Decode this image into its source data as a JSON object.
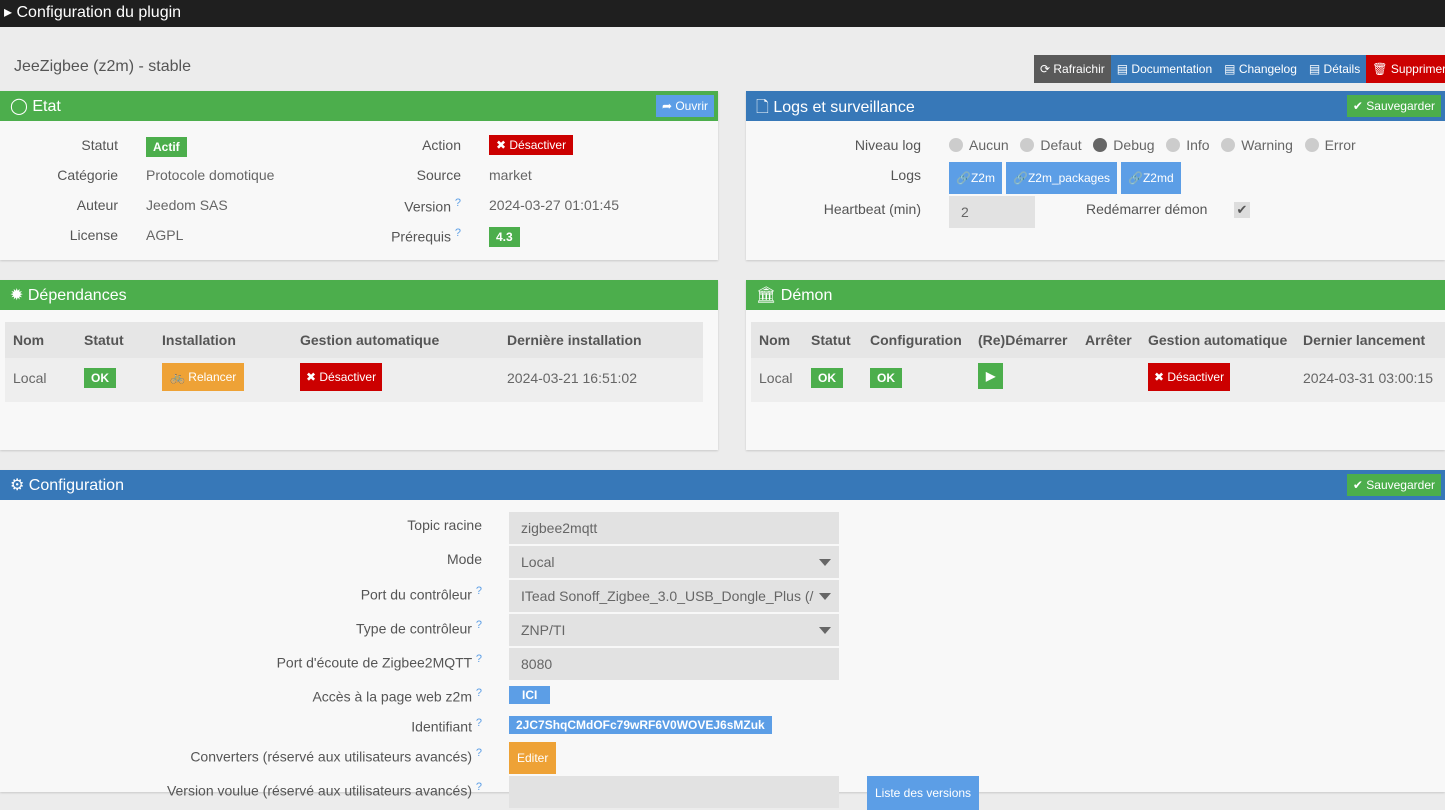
{
  "window_title": "Configuration du plugin",
  "plugin_title": "JeeZigbee (z2m) - stable",
  "toolbar": {
    "refresh": "Rafraichir",
    "documentation": "Documentation",
    "changelog": "Changelog",
    "details": "Détails",
    "delete": "Supprimer"
  },
  "etat": {
    "title": "Etat",
    "open": "Ouvrir",
    "statut_label": "Statut",
    "statut": "Actif",
    "categorie_label": "Catégorie",
    "categorie": "Protocole domotique",
    "auteur_label": "Auteur",
    "auteur": "Jeedom SAS",
    "license_label": "License",
    "license": "AGPL",
    "action_label": "Action",
    "action": "Désactiver",
    "source_label": "Source",
    "source": "market",
    "version_label": "Version",
    "version": "2024-03-27 01:01:45",
    "prerequis_label": "Prérequis",
    "prerequis": "4.3"
  },
  "logs": {
    "title": "Logs et surveillance",
    "save": "Sauvegarder",
    "niveau_label": "Niveau log",
    "levels": [
      "Aucun",
      "Defaut",
      "Debug",
      "Info",
      "Warning",
      "Error"
    ],
    "selected": "Debug",
    "logs_label": "Logs",
    "log_buttons": [
      "Z2m",
      "Z2m_packages",
      "Z2md"
    ],
    "heartbeat_label": "Heartbeat (min)",
    "heartbeat": "2",
    "restart_label": "Redémarrer démon"
  },
  "deps": {
    "title": "Dépendances",
    "headers": [
      "Nom",
      "Statut",
      "Installation",
      "Gestion automatique",
      "Dernière installation"
    ],
    "row": {
      "nom": "Local",
      "statut": "OK",
      "install": "Relancer",
      "auto": "Désactiver",
      "last": "2024-03-21 16:51:02"
    }
  },
  "demon": {
    "title": "Démon",
    "headers": [
      "Nom",
      "Statut",
      "Configuration",
      "(Re)Démarrer",
      "Arrêter",
      "Gestion automatique",
      "Dernier lancement"
    ],
    "row": {
      "nom": "Local",
      "statut": "OK",
      "config": "OK",
      "auto": "Désactiver",
      "last": "2024-03-31 03:00:15"
    }
  },
  "config": {
    "title": "Configuration",
    "save": "Sauvegarder",
    "topic_label": "Topic racine",
    "topic": "zigbee2mqtt",
    "mode_label": "Mode",
    "mode": "Local",
    "port_label": "Port du contrôleur",
    "port": "ITead Sonoff_Zigbee_3.0_USB_Dongle_Plus (/",
    "type_label": "Type de contrôleur",
    "type": "ZNP/TI",
    "listen_label": "Port d'écoute de Zigbee2MQTT",
    "listen": "8080",
    "web_label": "Accès à la page web z2m",
    "web": "ICI",
    "id_label": "Identifiant",
    "id": "2JC7ShqCMdOFc79wRF6V0WOVEJ6sMZuk",
    "conv_label": "Converters (réservé aux utilisateurs avancés)",
    "conv": "Editer",
    "ver_label": "Version voulue (réservé aux utilisateurs avancés)",
    "ver_list": "Liste des versions"
  }
}
